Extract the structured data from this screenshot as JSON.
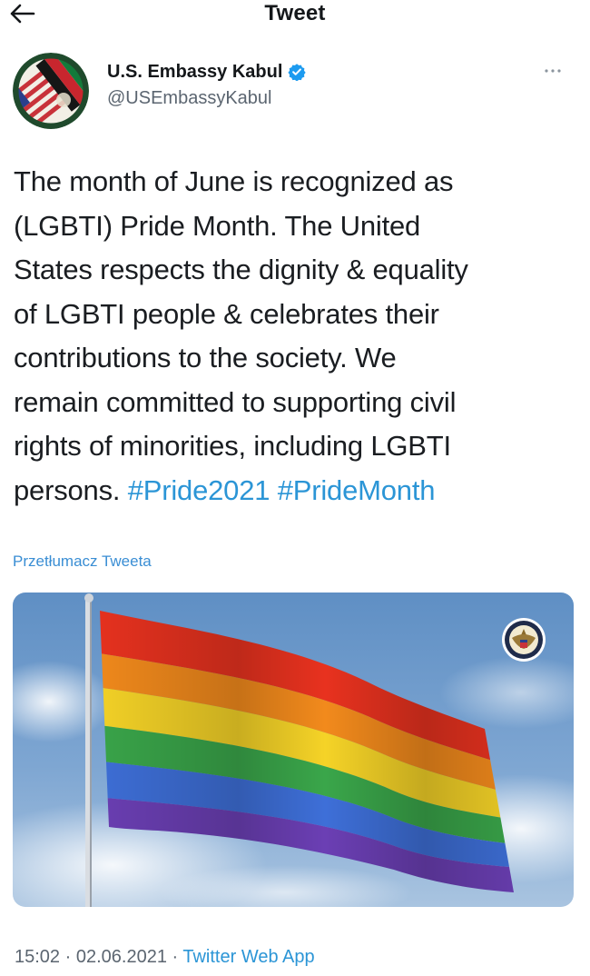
{
  "header": {
    "title": "Tweet"
  },
  "author": {
    "name": "U.S. Embassy Kabul",
    "handle": "@USEmbassyKabul"
  },
  "tweet": {
    "text_lines": [
      "The month of June is recognized as",
      "(LGBTI) Pride Month. The United",
      "States respects the dignity & equality",
      "of LGBTI people & celebrates their",
      "contributions to the society. We",
      "remain committed to supporting civil",
      "rights of minorities, including LGBTI",
      "persons. "
    ],
    "hashtags": [
      "#Pride2021",
      "#PrideMonth"
    ],
    "translate_label": "Przetłumacz Tweeta"
  },
  "media": {
    "alt": "Rainbow pride flag on a pole against a cloudy blue sky with U.S. Department of State seal",
    "flag_colors": [
      "#e8321f",
      "#f28a1c",
      "#f5d327",
      "#3aa64a",
      "#3e6fd8",
      "#6b3fb4"
    ]
  },
  "meta": {
    "time": "15:02",
    "separator": " · ",
    "date": "02.06.2021",
    "source": "Twitter Web App"
  },
  "colors": {
    "link": "#2b95d6",
    "text": "#1a1d21",
    "secondary": "#5b6570",
    "verified": "#1d9bf0"
  }
}
